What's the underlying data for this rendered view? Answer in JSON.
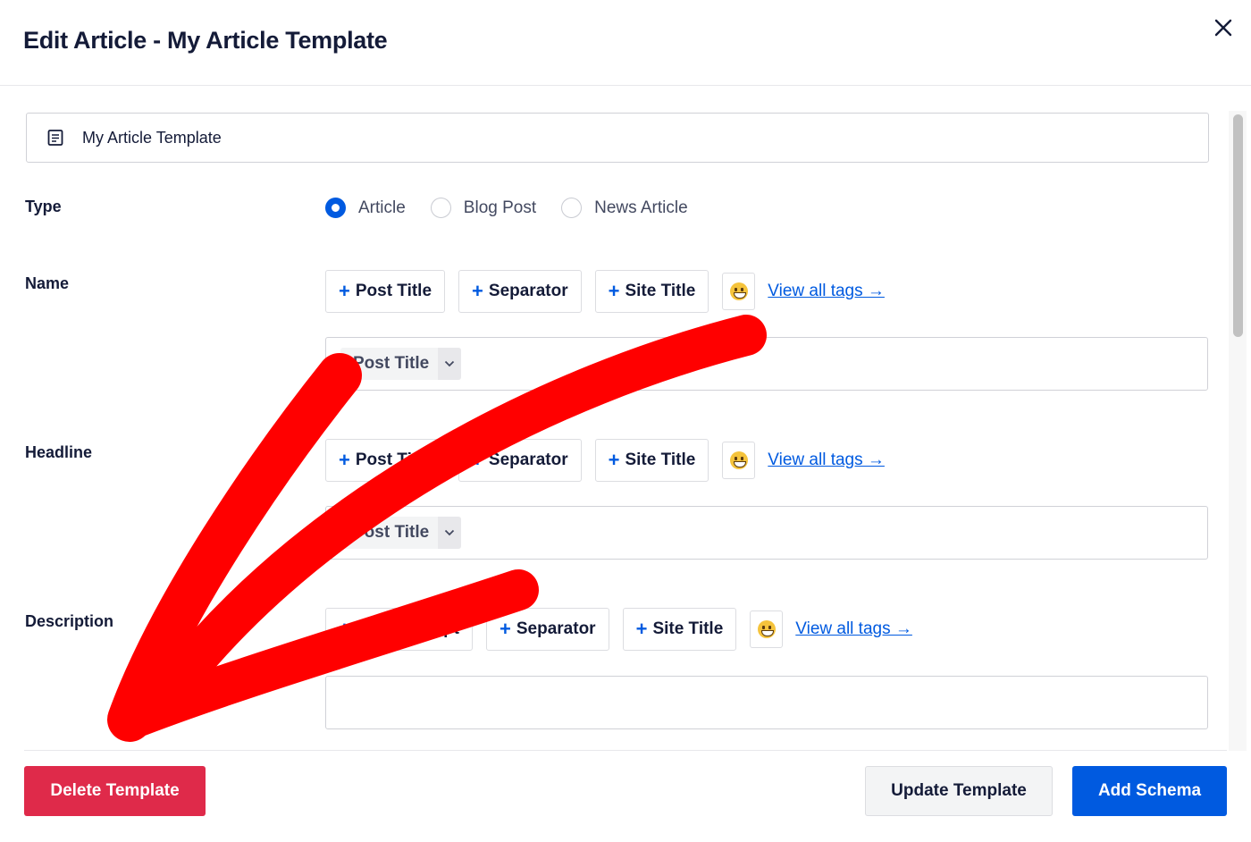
{
  "modal": {
    "title": "Edit Article - My Article Template",
    "close_icon": "close-icon"
  },
  "template_name": {
    "icon": "document-icon",
    "value": "My Article Template"
  },
  "type": {
    "label": "Type",
    "options": [
      {
        "label": "Article",
        "selected": true
      },
      {
        "label": "Blog Post",
        "selected": false
      },
      {
        "label": "News Article",
        "selected": false
      }
    ]
  },
  "fields": [
    {
      "label": "Name",
      "tags": [
        "Post Title",
        "Separator",
        "Site Title"
      ],
      "view_all": "View all tags →",
      "chips": [
        "Post Title"
      ]
    },
    {
      "label": "Headline",
      "tags": [
        "Post Title",
        "Separator",
        "Site Title"
      ],
      "view_all": "View all tags →",
      "chips": [
        "Post Title"
      ]
    },
    {
      "label": "Description",
      "tags": [
        "Post Excerpt",
        "Separator",
        "Site Title"
      ],
      "view_all": "View all tags →",
      "chips": []
    }
  ],
  "tag_plus": "+",
  "footer": {
    "delete_label": "Delete Template",
    "update_label": "Update Template",
    "add_label": "Add Schema"
  },
  "colors": {
    "primary": "#005ae0",
    "danger": "#df2a4a",
    "text": "#141b38",
    "annotation": "#ff0000"
  }
}
